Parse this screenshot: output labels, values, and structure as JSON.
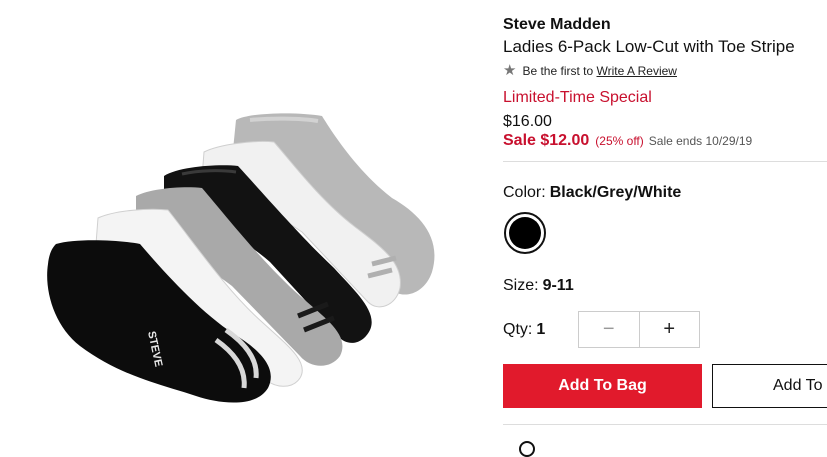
{
  "product": {
    "brand": "Steve Madden",
    "name": "Ladies 6-Pack Low-Cut with Toe Stripe",
    "image_brand_mark": "STEVE"
  },
  "review": {
    "star_icon": "star-icon",
    "prefix": "Be the first to",
    "link": "Write A Review"
  },
  "promo": {
    "label": "Limited-Time Special"
  },
  "price": {
    "original": "$16.00",
    "sale": "Sale $12.00",
    "percent_off": "(25% off)",
    "sale_ends": "Sale ends 10/29/19"
  },
  "color": {
    "label": "Color:",
    "value": "Black/Grey/White",
    "swatch_color": "#000000"
  },
  "size": {
    "label": "Size:",
    "value": "9-11"
  },
  "quantity": {
    "label": "Qty:",
    "value": "1",
    "minus": "−",
    "plus": "+"
  },
  "actions": {
    "add_to_bag": "Add To Bag",
    "add_to_list": "Add To"
  },
  "colors": {
    "sale_red": "#c8102e",
    "button_red": "#e11a2c"
  }
}
